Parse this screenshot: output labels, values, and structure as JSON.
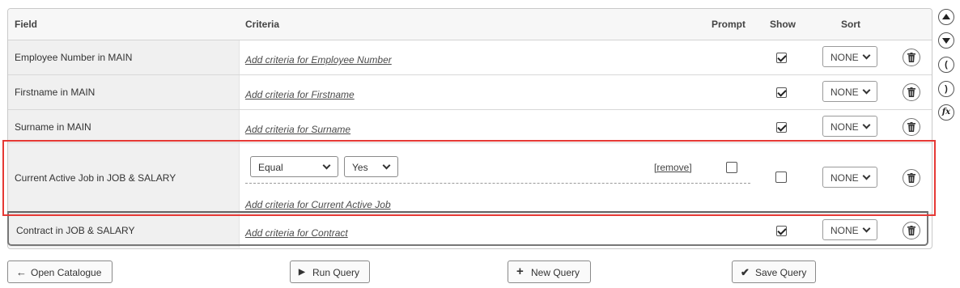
{
  "header": {
    "field": "Field",
    "criteria": "Criteria",
    "prompt": "Prompt",
    "show": "Show",
    "sort": "Sort"
  },
  "rows": [
    {
      "field": "Employee Number in MAIN",
      "add_criteria": "Add criteria for Employee Number",
      "show": true,
      "sort": "NONE"
    },
    {
      "field": "Firstname in MAIN",
      "add_criteria": "Add criteria for Firstname",
      "show": true,
      "sort": "NONE"
    },
    {
      "field": "Surname in MAIN",
      "add_criteria": "Add criteria for Surname",
      "show": true,
      "sort": "NONE"
    },
    {
      "field": "Current Active Job in JOB & SALARY",
      "add_criteria": "Add criteria for Current Active Job",
      "show": false,
      "sort": "NONE",
      "criterion": {
        "operator": "Equal",
        "value": "Yes",
        "remove": "[remove]",
        "prompt": false
      }
    },
    {
      "field": "Contract in JOB & SALARY",
      "add_criteria": "Add criteria for Contract",
      "show": true,
      "sort": "NONE"
    }
  ],
  "side_icons": [
    "move-up-icon",
    "move-down-icon",
    "open-paren-icon",
    "close-paren-icon",
    "function-icon"
  ],
  "side_glyphs": {
    "open": "(",
    "close": ")",
    "fx": "fx"
  },
  "buttons": {
    "open_catalogue": "Open Catalogue",
    "run_query": "Run Query",
    "new_query": "New Query",
    "save_query": "Save Query"
  },
  "colors": {
    "highlight": "#e53935",
    "field_bg": "#f0f0f0"
  }
}
